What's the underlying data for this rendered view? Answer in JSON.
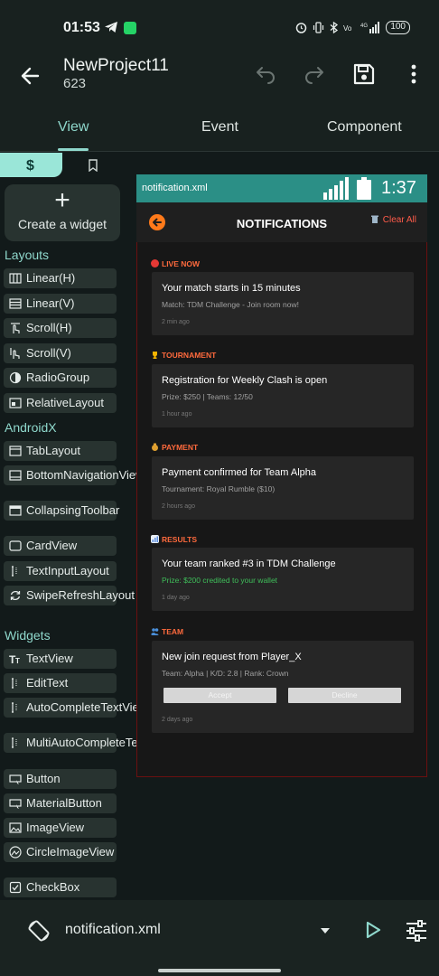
{
  "status_bar": {
    "time": "01:53",
    "battery": "100"
  },
  "app_bar": {
    "title": "NewProject11",
    "subtitle": "623"
  },
  "tabs": [
    {
      "label": "View"
    },
    {
      "label": "Event"
    },
    {
      "label": "Component"
    }
  ],
  "palette": {
    "create_widget_label": "Create a widget",
    "sections": [
      {
        "title": "Layouts",
        "items": [
          "Linear(H)",
          "Linear(V)",
          "Scroll(H)",
          "Scroll(V)",
          "RadioGroup",
          "RelativeLayout"
        ]
      },
      {
        "title": "AndroidX",
        "items": [
          "TabLayout",
          "BottomNavigationView",
          "CollapsingToolbar",
          "CardView",
          "TextInputLayout",
          "SwipeRefreshLayout"
        ]
      },
      {
        "title": "Widgets",
        "items": [
          "TextView",
          "EditText",
          "AutoCompleteTextView",
          "MultiAutoCompleteTextView",
          "Button",
          "MaterialButton",
          "ImageView",
          "CircleImageView",
          "CheckBox"
        ]
      }
    ]
  },
  "preview": {
    "file_name": "notification.xml",
    "time": "1:37",
    "header_title": "NOTIFICATIONS",
    "clear_all": "Clear All",
    "categories": [
      {
        "label": "LIVE NOW",
        "icon": "red-circle-icon",
        "color": "#e53935",
        "title": "Your match starts in 15 minutes",
        "subtitle": "Match: TDM Challenge - Join room now!",
        "time": "2 min ago"
      },
      {
        "label": "TOURNAMENT",
        "icon": "trophy-icon",
        "color": "#f4b400",
        "title": "Registration for Weekly Clash is open",
        "subtitle": "Prize: $250 | Teams: 12/50",
        "time": "1 hour ago"
      },
      {
        "label": "PAYMENT",
        "icon": "money-bag-icon",
        "color": "#e0a030",
        "title": "Payment confirmed for Team Alpha",
        "subtitle": "Tournament: Royal Rumble ($10)",
        "time": "2 hours ago"
      },
      {
        "label": "RESULTS",
        "icon": "bar-chart-icon",
        "color": "#5c8de0",
        "title": "Your team ranked #3 in TDM Challenge",
        "subtitle": "Prize: $200 credited to your wallet",
        "time": "1 day ago"
      },
      {
        "label": "TEAM",
        "icon": "people-icon",
        "color": "#4a8fd9",
        "title": "New join request from Player_X",
        "subtitle": "Team: Alpha | K/D: 2.8 | Rank: Crown",
        "time": "2 days ago",
        "accept": "Accept",
        "decline": "Decline"
      }
    ]
  },
  "bottom_bar": {
    "file_name": "notification.xml"
  },
  "colors": {
    "accent": "#8fd8cc",
    "preview_bar": "#2b8f86",
    "notif_accent": "#ff6a3d",
    "danger": "#ff5b4a",
    "success": "#3fbf5a"
  }
}
